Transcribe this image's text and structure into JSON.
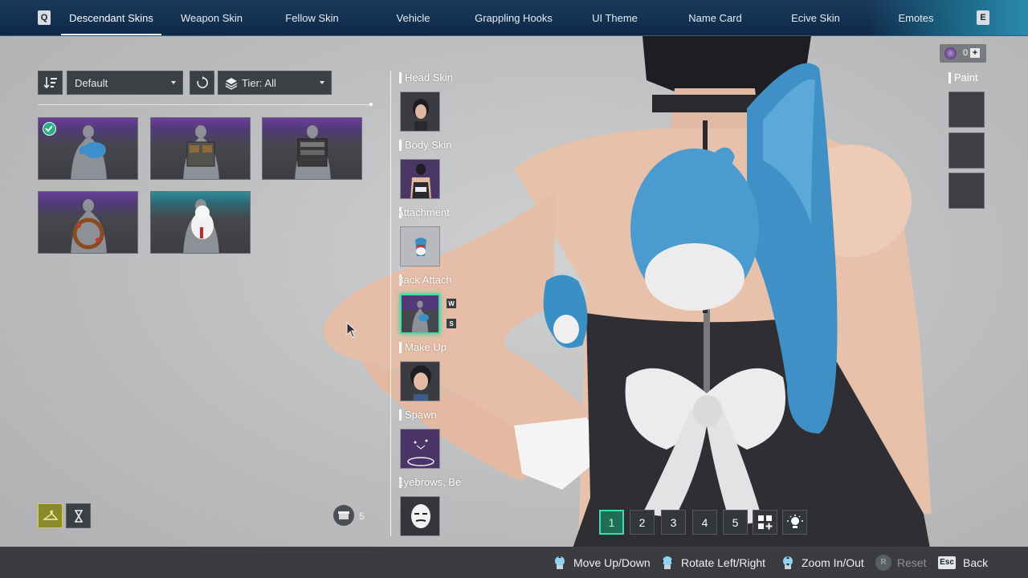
{
  "topnav": {
    "left_key": "Q",
    "right_key": "E",
    "tabs": [
      {
        "label": "Descendant Skins",
        "active": true
      },
      {
        "label": "Weapon Skin",
        "active": false
      },
      {
        "label": "Fellow Skin",
        "active": false
      },
      {
        "label": "Vehicle",
        "active": false
      },
      {
        "label": "Grappling Hooks",
        "active": false
      },
      {
        "label": "UI Theme",
        "active": false
      },
      {
        "label": "Name Card",
        "active": false
      },
      {
        "label": "Ecive Skin",
        "active": false
      },
      {
        "label": "Emotes",
        "active": false
      }
    ]
  },
  "toolbar": {
    "sort_value": "Default",
    "tier_value": "Tier: All"
  },
  "items": [
    {
      "id": "shark-plush",
      "equipped": true,
      "tier": "purple"
    },
    {
      "id": "tactical-pack-1",
      "equipped": false,
      "tier": "purple"
    },
    {
      "id": "tactical-pack-2",
      "equipped": false,
      "tier": "purple"
    },
    {
      "id": "wreath",
      "equipped": false,
      "tier": "purple"
    },
    {
      "id": "polar-bear",
      "equipped": false,
      "tier": "teal"
    }
  ],
  "slots": [
    {
      "label": "Head Skin"
    },
    {
      "label": "Body Skin"
    },
    {
      "label": "Attachment"
    },
    {
      "label": "Back Attach"
    },
    {
      "label": "Make Up"
    },
    {
      "label": "Spawn"
    },
    {
      "label": "Eyebrows, Be"
    }
  ],
  "slot_keys": {
    "up": "W",
    "down": "S"
  },
  "storage": {
    "count": "5"
  },
  "currency": {
    "amount": "0",
    "plus": "+"
  },
  "paint": {
    "label": "Paint"
  },
  "presets": [
    "1",
    "2",
    "3",
    "4",
    "5"
  ],
  "hints": {
    "move": "Move Up/Down",
    "rotate": "Rotate Left/Right",
    "zoom": "Zoom In/Out",
    "reset_key": "R",
    "reset": "Reset",
    "back_key": "Esc",
    "back": "Back"
  },
  "colors": {
    "accent_green": "#39e0a8",
    "nav_bg": "#123050",
    "purple_tier": "#6b3e9c",
    "teal_tier": "#2c8e9a"
  }
}
